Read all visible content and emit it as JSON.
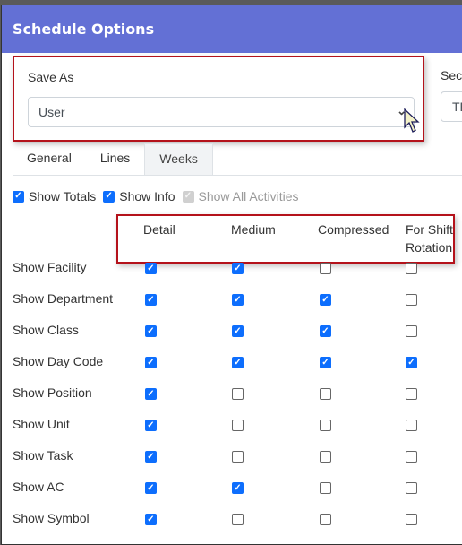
{
  "dialog": {
    "title": "Schedule Options"
  },
  "save_as": {
    "label": "Save As",
    "value": "User",
    "chevron": "⌄"
  },
  "second_field": {
    "label_visible": "Sec",
    "value_visible": "TE"
  },
  "tabs": [
    {
      "label": "General",
      "active": false
    },
    {
      "label": "Lines",
      "active": false
    },
    {
      "label": "Weeks",
      "active": true
    }
  ],
  "options": [
    {
      "label": "Show Totals",
      "checked": true,
      "disabled": false
    },
    {
      "label": "Show Info",
      "checked": true,
      "disabled": false
    },
    {
      "label": "Show All Activities",
      "checked": true,
      "disabled": true
    }
  ],
  "columns": [
    "Detail",
    "Medium",
    "Compressed",
    "For Shift Rotation"
  ],
  "column_lines": [
    [
      "Detail"
    ],
    [
      "Medium"
    ],
    [
      "Compressed"
    ],
    [
      "For Shift",
      "Rotation"
    ]
  ],
  "rows": [
    {
      "label": "Show Facility",
      "values": [
        true,
        true,
        false,
        false
      ]
    },
    {
      "label": "Show Department",
      "values": [
        true,
        true,
        true,
        false
      ]
    },
    {
      "label": "Show Class",
      "values": [
        true,
        true,
        true,
        false
      ]
    },
    {
      "label": "Show Day Code",
      "values": [
        true,
        true,
        true,
        true
      ]
    },
    {
      "label": "Show Position",
      "values": [
        true,
        false,
        false,
        false
      ]
    },
    {
      "label": "Show Unit",
      "values": [
        true,
        false,
        false,
        false
      ]
    },
    {
      "label": "Show Task",
      "values": [
        true,
        false,
        false,
        false
      ]
    },
    {
      "label": "Show AC",
      "values": [
        true,
        true,
        false,
        false
      ]
    },
    {
      "label": "Show Symbol",
      "values": [
        true,
        false,
        false,
        false
      ]
    }
  ],
  "colors": {
    "header": "#6370d5",
    "checkbox_checked": "#0d6efd",
    "highlight_border": "#b4121b"
  }
}
